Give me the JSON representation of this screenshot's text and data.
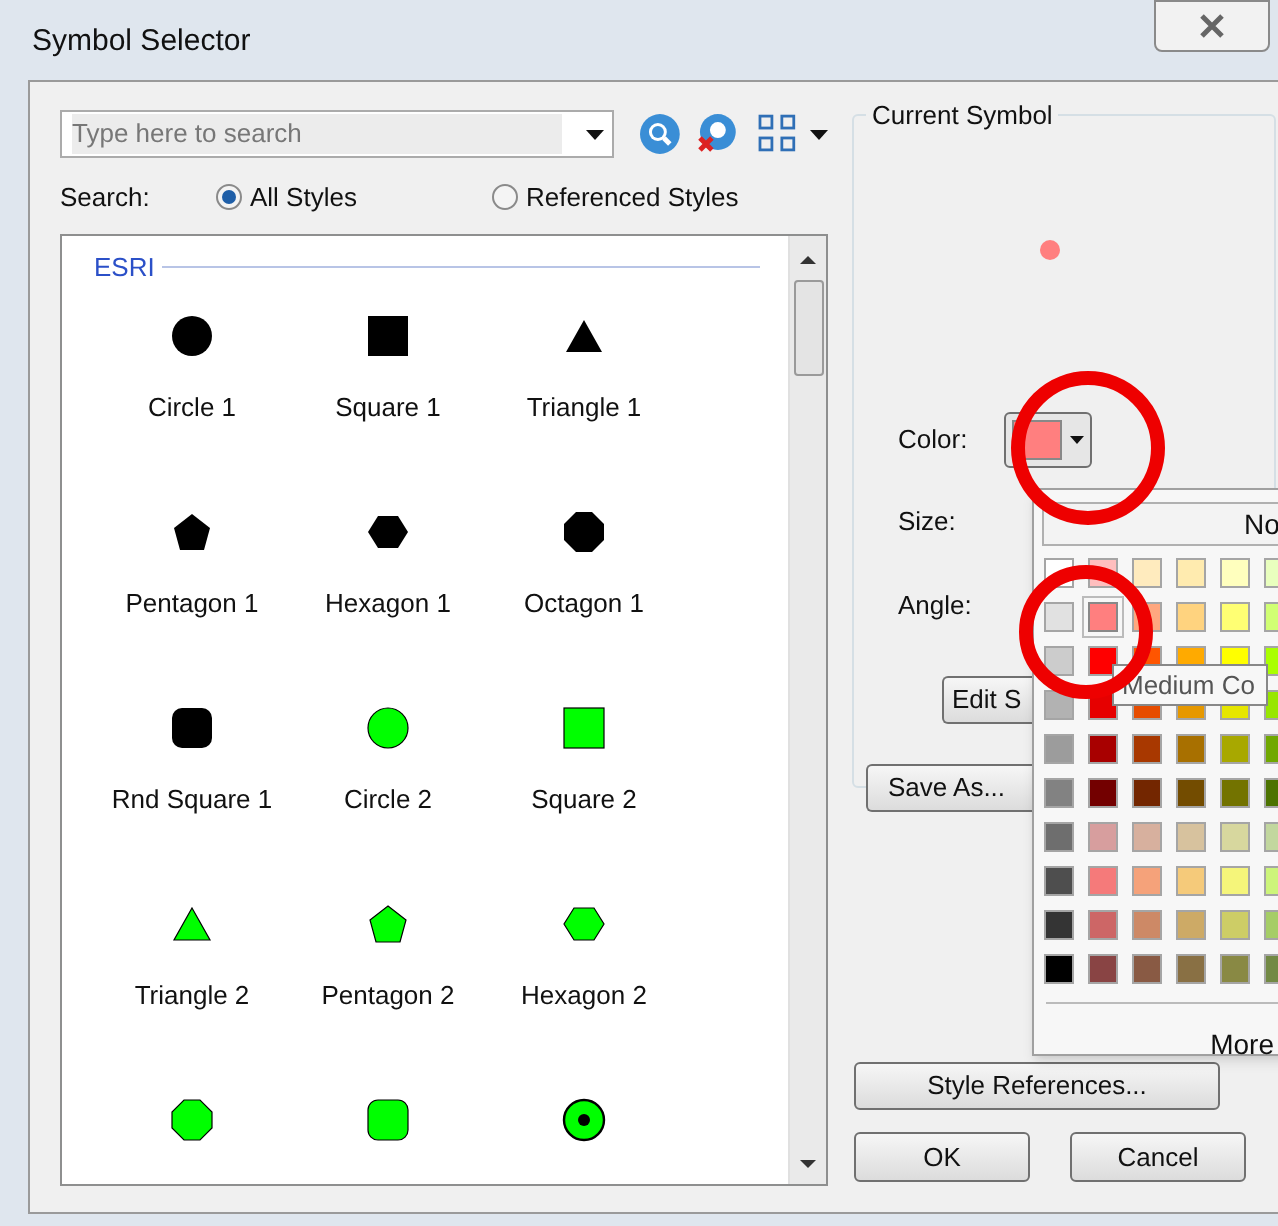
{
  "window": {
    "title": "Symbol Selector"
  },
  "search": {
    "placeholder": "Type here to search",
    "label": "Search:",
    "scopes": [
      {
        "label": "All Styles",
        "selected": true
      },
      {
        "label": "Referenced Styles",
        "selected": false
      }
    ]
  },
  "gallery": {
    "group": "ESRI",
    "items": [
      {
        "label": "Circle 1",
        "kind": "circle",
        "color": "#000000"
      },
      {
        "label": "Square 1",
        "kind": "square",
        "color": "#000000"
      },
      {
        "label": "Triangle 1",
        "kind": "triangle",
        "color": "#000000"
      },
      {
        "label": "Pentagon 1",
        "kind": "pentagon",
        "color": "#000000"
      },
      {
        "label": "Hexagon 1",
        "kind": "hexagon",
        "color": "#000000"
      },
      {
        "label": "Octagon 1",
        "kind": "octagon",
        "color": "#000000"
      },
      {
        "label": "Rnd Square 1",
        "kind": "roundsquare",
        "color": "#000000"
      },
      {
        "label": "Circle 2",
        "kind": "circle",
        "color": "#00ff00"
      },
      {
        "label": "Square 2",
        "kind": "square",
        "color": "#00ff00"
      },
      {
        "label": "Triangle 2",
        "kind": "triangle",
        "color": "#00ff00"
      },
      {
        "label": "Pentagon 2",
        "kind": "pentagon",
        "color": "#00ff00"
      },
      {
        "label": "Hexagon 2",
        "kind": "hexagon",
        "color": "#00ff00"
      },
      {
        "kind": "octagon",
        "color": "#00ff00"
      },
      {
        "kind": "roundsquare",
        "color": "#00ff00"
      },
      {
        "kind": "dotcircle",
        "color": "#00ff00"
      }
    ]
  },
  "current_symbol": {
    "title": "Current Symbol",
    "color": "#ff7f7f",
    "color_label": "Color:",
    "size_label": "Size:",
    "angle_label": "Angle:",
    "edit_button": "Edit S",
    "save_button": "Save As..."
  },
  "buttons": {
    "style_references": "Style References...",
    "ok": "OK",
    "cancel": "Cancel"
  },
  "color_palette": {
    "no_color": "No",
    "more": "More",
    "tooltip": "Medium Co",
    "rows": [
      [
        {
          "color": "#ffffff",
          "selected": false
        },
        {
          "color": "#ffbebe",
          "selected": false
        },
        {
          "color": "#ffebbe",
          "selected": false
        },
        {
          "color": "#ffebaf",
          "selected": false
        },
        {
          "color": "#ffffbe",
          "selected": false
        },
        {
          "color": "#e9ffbe",
          "selected": false
        }
      ],
      [
        {
          "color": "#e1e1e1",
          "selected": false
        },
        {
          "color": "#ff7f7f",
          "selected": true
        },
        {
          "color": "#ffa77f",
          "selected": false
        },
        {
          "color": "#ffd37f",
          "selected": false
        },
        {
          "color": "#ffff73",
          "selected": false
        },
        {
          "color": "#d1ff73",
          "selected": false
        }
      ],
      [
        {
          "color": "#cccccc",
          "selected": false
        },
        {
          "color": "#ff0000",
          "selected": false
        },
        {
          "color": "#ff5500",
          "selected": false
        },
        {
          "color": "#ffaa00",
          "selected": false
        },
        {
          "color": "#ffff00",
          "selected": false
        },
        {
          "color": "#aaff00",
          "selected": false
        }
      ],
      [
        {
          "color": "#b2b2b2",
          "selected": false
        },
        {
          "color": "#e60000",
          "selected": false
        },
        {
          "color": "#e64c00",
          "selected": false
        },
        {
          "color": "#e69800",
          "selected": false
        },
        {
          "color": "#e6e600",
          "selected": false
        },
        {
          "color": "#98e600",
          "selected": false
        }
      ],
      [
        {
          "color": "#9c9c9c",
          "selected": false
        },
        {
          "color": "#a80000",
          "selected": false
        },
        {
          "color": "#a83800",
          "selected": false
        },
        {
          "color": "#a87000",
          "selected": false
        },
        {
          "color": "#a8a800",
          "selected": false
        },
        {
          "color": "#70a800",
          "selected": false
        }
      ],
      [
        {
          "color": "#828282",
          "selected": false
        },
        {
          "color": "#730000",
          "selected": false
        },
        {
          "color": "#732600",
          "selected": false
        },
        {
          "color": "#734c00",
          "selected": false
        },
        {
          "color": "#737300",
          "selected": false
        },
        {
          "color": "#4c7300",
          "selected": false
        }
      ],
      [
        {
          "color": "#6e6e6e",
          "selected": false
        },
        {
          "color": "#d79e9e",
          "selected": false
        },
        {
          "color": "#d7b09e",
          "selected": false
        },
        {
          "color": "#d7c29e",
          "selected": false
        },
        {
          "color": "#d7d79e",
          "selected": false
        },
        {
          "color": "#c2d79e",
          "selected": false
        }
      ],
      [
        {
          "color": "#4e4e4e",
          "selected": false
        },
        {
          "color": "#f57a7a",
          "selected": false
        },
        {
          "color": "#f5a27a",
          "selected": false
        },
        {
          "color": "#f5ca7a",
          "selected": false
        },
        {
          "color": "#f5f57a",
          "selected": false
        },
        {
          "color": "#cdf57a",
          "selected": false
        }
      ],
      [
        {
          "color": "#343434",
          "selected": false
        },
        {
          "color": "#cd6666",
          "selected": false
        },
        {
          "color": "#cd8966",
          "selected": false
        },
        {
          "color": "#cdaa66",
          "selected": false
        },
        {
          "color": "#cdcd66",
          "selected": false
        },
        {
          "color": "#a5cd66",
          "selected": false
        }
      ],
      [
        {
          "color": "#000000",
          "selected": false
        },
        {
          "color": "#894444",
          "selected": false
        },
        {
          "color": "#895a44",
          "selected": false
        },
        {
          "color": "#897044",
          "selected": false
        },
        {
          "color": "#898944",
          "selected": false
        },
        {
          "color": "#728944",
          "selected": false
        }
      ]
    ]
  }
}
